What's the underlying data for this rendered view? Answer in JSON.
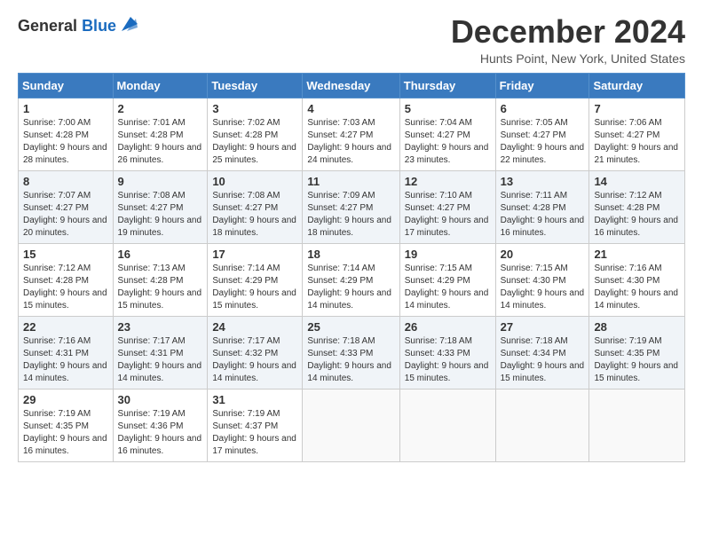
{
  "app": {
    "logo_general": "General",
    "logo_blue": "Blue",
    "month_title": "December 2024",
    "location": "Hunts Point, New York, United States"
  },
  "calendar": {
    "days_of_week": [
      "Sunday",
      "Monday",
      "Tuesday",
      "Wednesday",
      "Thursday",
      "Friday",
      "Saturday"
    ],
    "weeks": [
      [
        {
          "day": 1,
          "sunrise": "7:00 AM",
          "sunset": "4:28 PM",
          "daylight": "9 hours and 28 minutes."
        },
        {
          "day": 2,
          "sunrise": "7:01 AM",
          "sunset": "4:28 PM",
          "daylight": "9 hours and 26 minutes."
        },
        {
          "day": 3,
          "sunrise": "7:02 AM",
          "sunset": "4:28 PM",
          "daylight": "9 hours and 25 minutes."
        },
        {
          "day": 4,
          "sunrise": "7:03 AM",
          "sunset": "4:27 PM",
          "daylight": "9 hours and 24 minutes."
        },
        {
          "day": 5,
          "sunrise": "7:04 AM",
          "sunset": "4:27 PM",
          "daylight": "9 hours and 23 minutes."
        },
        {
          "day": 6,
          "sunrise": "7:05 AM",
          "sunset": "4:27 PM",
          "daylight": "9 hours and 22 minutes."
        },
        {
          "day": 7,
          "sunrise": "7:06 AM",
          "sunset": "4:27 PM",
          "daylight": "9 hours and 21 minutes."
        }
      ],
      [
        {
          "day": 8,
          "sunrise": "7:07 AM",
          "sunset": "4:27 PM",
          "daylight": "9 hours and 20 minutes."
        },
        {
          "day": 9,
          "sunrise": "7:08 AM",
          "sunset": "4:27 PM",
          "daylight": "9 hours and 19 minutes."
        },
        {
          "day": 10,
          "sunrise": "7:08 AM",
          "sunset": "4:27 PM",
          "daylight": "9 hours and 18 minutes."
        },
        {
          "day": 11,
          "sunrise": "7:09 AM",
          "sunset": "4:27 PM",
          "daylight": "9 hours and 18 minutes."
        },
        {
          "day": 12,
          "sunrise": "7:10 AM",
          "sunset": "4:27 PM",
          "daylight": "9 hours and 17 minutes."
        },
        {
          "day": 13,
          "sunrise": "7:11 AM",
          "sunset": "4:28 PM",
          "daylight": "9 hours and 16 minutes."
        },
        {
          "day": 14,
          "sunrise": "7:12 AM",
          "sunset": "4:28 PM",
          "daylight": "9 hours and 16 minutes."
        }
      ],
      [
        {
          "day": 15,
          "sunrise": "7:12 AM",
          "sunset": "4:28 PM",
          "daylight": "9 hours and 15 minutes."
        },
        {
          "day": 16,
          "sunrise": "7:13 AM",
          "sunset": "4:28 PM",
          "daylight": "9 hours and 15 minutes."
        },
        {
          "day": 17,
          "sunrise": "7:14 AM",
          "sunset": "4:29 PM",
          "daylight": "9 hours and 15 minutes."
        },
        {
          "day": 18,
          "sunrise": "7:14 AM",
          "sunset": "4:29 PM",
          "daylight": "9 hours and 14 minutes."
        },
        {
          "day": 19,
          "sunrise": "7:15 AM",
          "sunset": "4:29 PM",
          "daylight": "9 hours and 14 minutes."
        },
        {
          "day": 20,
          "sunrise": "7:15 AM",
          "sunset": "4:30 PM",
          "daylight": "9 hours and 14 minutes."
        },
        {
          "day": 21,
          "sunrise": "7:16 AM",
          "sunset": "4:30 PM",
          "daylight": "9 hours and 14 minutes."
        }
      ],
      [
        {
          "day": 22,
          "sunrise": "7:16 AM",
          "sunset": "4:31 PM",
          "daylight": "9 hours and 14 minutes."
        },
        {
          "day": 23,
          "sunrise": "7:17 AM",
          "sunset": "4:31 PM",
          "daylight": "9 hours and 14 minutes."
        },
        {
          "day": 24,
          "sunrise": "7:17 AM",
          "sunset": "4:32 PM",
          "daylight": "9 hours and 14 minutes."
        },
        {
          "day": 25,
          "sunrise": "7:18 AM",
          "sunset": "4:33 PM",
          "daylight": "9 hours and 14 minutes."
        },
        {
          "day": 26,
          "sunrise": "7:18 AM",
          "sunset": "4:33 PM",
          "daylight": "9 hours and 15 minutes."
        },
        {
          "day": 27,
          "sunrise": "7:18 AM",
          "sunset": "4:34 PM",
          "daylight": "9 hours and 15 minutes."
        },
        {
          "day": 28,
          "sunrise": "7:19 AM",
          "sunset": "4:35 PM",
          "daylight": "9 hours and 15 minutes."
        }
      ],
      [
        {
          "day": 29,
          "sunrise": "7:19 AM",
          "sunset": "4:35 PM",
          "daylight": "9 hours and 16 minutes."
        },
        {
          "day": 30,
          "sunrise": "7:19 AM",
          "sunset": "4:36 PM",
          "daylight": "9 hours and 16 minutes."
        },
        {
          "day": 31,
          "sunrise": "7:19 AM",
          "sunset": "4:37 PM",
          "daylight": "9 hours and 17 minutes."
        },
        null,
        null,
        null,
        null
      ]
    ]
  }
}
